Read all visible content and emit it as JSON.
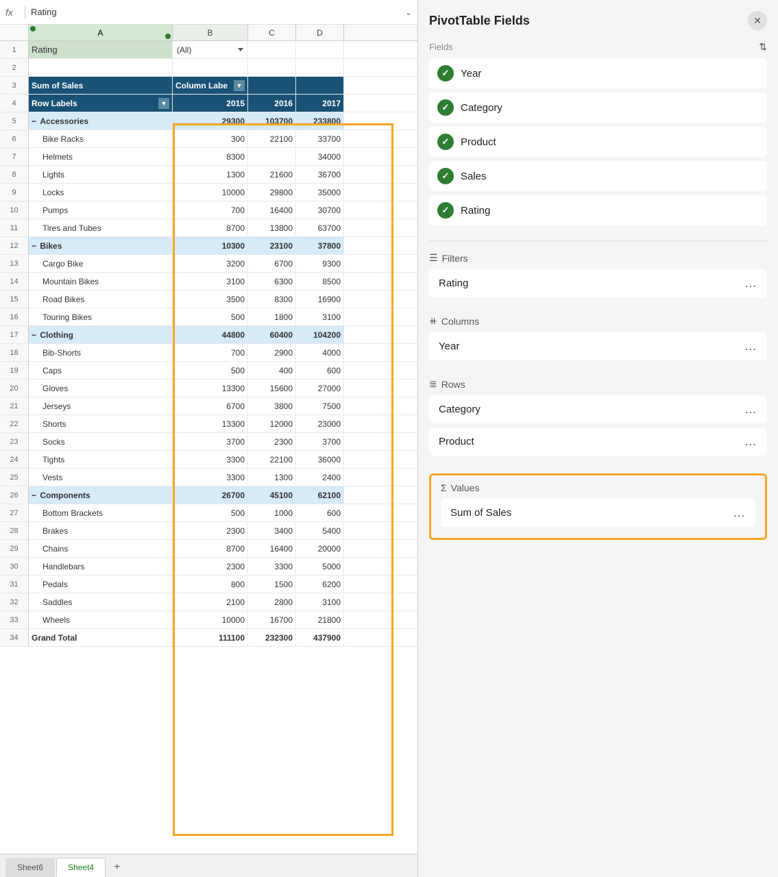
{
  "formula_bar": {
    "fx": "fx",
    "value": "Rating"
  },
  "columns": {
    "row_num": "",
    "a": "A",
    "b": "B",
    "c": "C",
    "d": "D"
  },
  "pivot": {
    "header": {
      "sum_of_sales": "Sum of Sales",
      "column_label": "Column Labe",
      "row_labels": "Row Labels"
    },
    "years": [
      "2015",
      "2016",
      "2017"
    ],
    "filter": {
      "field": "Rating",
      "value": "(All)"
    },
    "categories": [
      {
        "name": "Accessories",
        "vals": [
          "29300",
          "103700",
          "233800"
        ],
        "products": [
          {
            "name": "Bike Racks",
            "vals": [
              "300",
              "22100",
              "33700"
            ]
          },
          {
            "name": "Helmets",
            "vals": [
              "8300",
              "",
              "34000"
            ]
          },
          {
            "name": "Lights",
            "vals": [
              "1300",
              "21600",
              "36700"
            ]
          },
          {
            "name": "Locks",
            "vals": [
              "10000",
              "29800",
              "35000"
            ]
          },
          {
            "name": "Pumps",
            "vals": [
              "700",
              "16400",
              "30700"
            ]
          },
          {
            "name": "Tires and Tubes",
            "vals": [
              "8700",
              "13800",
              "63700"
            ]
          }
        ]
      },
      {
        "name": "Bikes",
        "vals": [
          "10300",
          "23100",
          "37800"
        ],
        "products": [
          {
            "name": "Cargo Bike",
            "vals": [
              "3200",
              "6700",
              "9300"
            ]
          },
          {
            "name": "Mountain Bikes",
            "vals": [
              "3100",
              "6300",
              "8500"
            ]
          },
          {
            "name": "Road Bikes",
            "vals": [
              "3500",
              "8300",
              "16900"
            ]
          },
          {
            "name": "Touring Bikes",
            "vals": [
              "500",
              "1800",
              "3100"
            ]
          }
        ]
      },
      {
        "name": "Clothing",
        "vals": [
          "44800",
          "60400",
          "104200"
        ],
        "products": [
          {
            "name": "Bib-Shorts",
            "vals": [
              "700",
              "2900",
              "4000"
            ]
          },
          {
            "name": "Caps",
            "vals": [
              "500",
              "400",
              "600"
            ]
          },
          {
            "name": "Gloves",
            "vals": [
              "13300",
              "15600",
              "27000"
            ]
          },
          {
            "name": "Jerseys",
            "vals": [
              "6700",
              "3800",
              "7500"
            ]
          },
          {
            "name": "Shorts",
            "vals": [
              "13300",
              "12000",
              "23000"
            ]
          },
          {
            "name": "Socks",
            "vals": [
              "3700",
              "2300",
              "3700"
            ]
          },
          {
            "name": "Tights",
            "vals": [
              "3300",
              "22100",
              "36000"
            ]
          },
          {
            "name": "Vests",
            "vals": [
              "3300",
              "1300",
              "2400"
            ]
          }
        ]
      },
      {
        "name": "Components",
        "vals": [
          "26700",
          "45100",
          "62100"
        ],
        "products": [
          {
            "name": "Bottom Brackets",
            "vals": [
              "500",
              "1000",
              "600"
            ]
          },
          {
            "name": "Brakes",
            "vals": [
              "2300",
              "3400",
              "5400"
            ]
          },
          {
            "name": "Chains",
            "vals": [
              "8700",
              "16400",
              "20000"
            ]
          },
          {
            "name": "Handlebars",
            "vals": [
              "2300",
              "3300",
              "5000"
            ]
          },
          {
            "name": "Pedals",
            "vals": [
              "800",
              "1500",
              "6200"
            ]
          },
          {
            "name": "Saddles",
            "vals": [
              "2100",
              "2800",
              "3100"
            ]
          },
          {
            "name": "Wheels",
            "vals": [
              "10000",
              "16700",
              "21800"
            ]
          }
        ]
      }
    ],
    "grand_total": {
      "label": "Grand Total",
      "vals": [
        "111100",
        "232300",
        "437900"
      ]
    }
  },
  "pivot_panel": {
    "title": "PivotTable Fields",
    "close": "×",
    "fields_label": "Fields",
    "fields": [
      {
        "id": "year",
        "label": "Year",
        "checked": true
      },
      {
        "id": "category",
        "label": "Category",
        "checked": true
      },
      {
        "id": "product",
        "label": "Product",
        "checked": true
      },
      {
        "id": "sales",
        "label": "Sales",
        "checked": true
      },
      {
        "id": "rating",
        "label": "Rating",
        "checked": true
      }
    ],
    "filters_label": "Filters",
    "filters": [
      {
        "id": "rating-filter",
        "label": "Rating"
      }
    ],
    "columns_label": "Columns",
    "columns": [
      {
        "id": "year-col",
        "label": "Year"
      }
    ],
    "rows_label": "Rows",
    "rows": [
      {
        "id": "category-row",
        "label": "Category"
      },
      {
        "id": "product-row",
        "label": "Product"
      }
    ],
    "values_label": "Values",
    "values": [
      {
        "id": "sum-sales",
        "label": "Sum of Sales"
      }
    ]
  },
  "tabs": {
    "sheet6": "Sheet6",
    "sheet4": "Sheet4",
    "add": "+"
  },
  "row_numbers": [
    "1",
    "2",
    "3",
    "4",
    "5",
    "6",
    "7",
    "8",
    "9",
    "10",
    "11",
    "12",
    "13",
    "14",
    "15",
    "16",
    "17",
    "18",
    "19",
    "20",
    "21",
    "22",
    "23",
    "24",
    "25",
    "26",
    "27",
    "28",
    "29",
    "30",
    "31",
    "32",
    "33",
    "34"
  ]
}
